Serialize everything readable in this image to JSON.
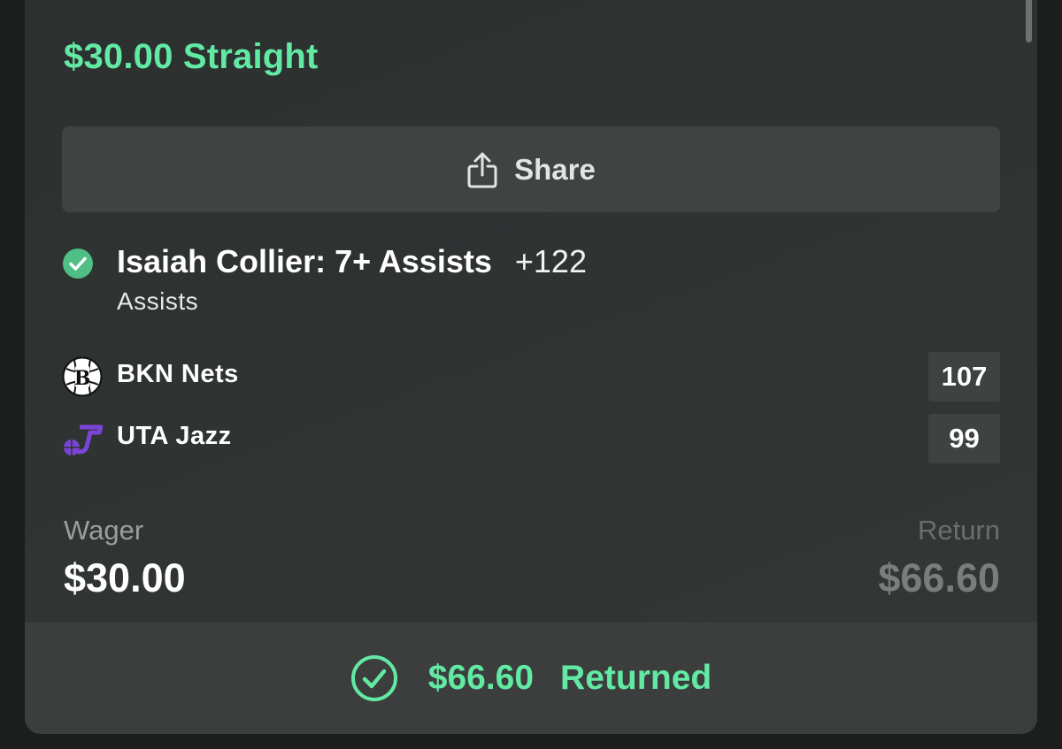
{
  "bet": {
    "title": "$30.00 Straight"
  },
  "share_button": {
    "label": "Share",
    "icon": "share-icon"
  },
  "selection": {
    "status_icon": "check-circle-icon",
    "title": "Isaiah Collier: 7+ Assists",
    "odds": "+122",
    "market": "Assists"
  },
  "teams": [
    {
      "name": "BKN Nets",
      "score": "107",
      "logo": "nets-logo"
    },
    {
      "name": "UTA Jazz",
      "score": "99",
      "logo": "jazz-logo"
    }
  ],
  "wager": {
    "label": "Wager",
    "value": "$30.00"
  },
  "return": {
    "label": "Return",
    "value": "$66.60"
  },
  "footer": {
    "amount": "$66.60",
    "status": "Returned",
    "icon": "check-circle-outline-icon"
  },
  "colors": {
    "accent_green": "#62e9a4",
    "card_bg": "#2f3332",
    "button_bg": "#3f4443",
    "score_bg": "#3e4241",
    "jazz_purple": "#6e3cc8"
  }
}
